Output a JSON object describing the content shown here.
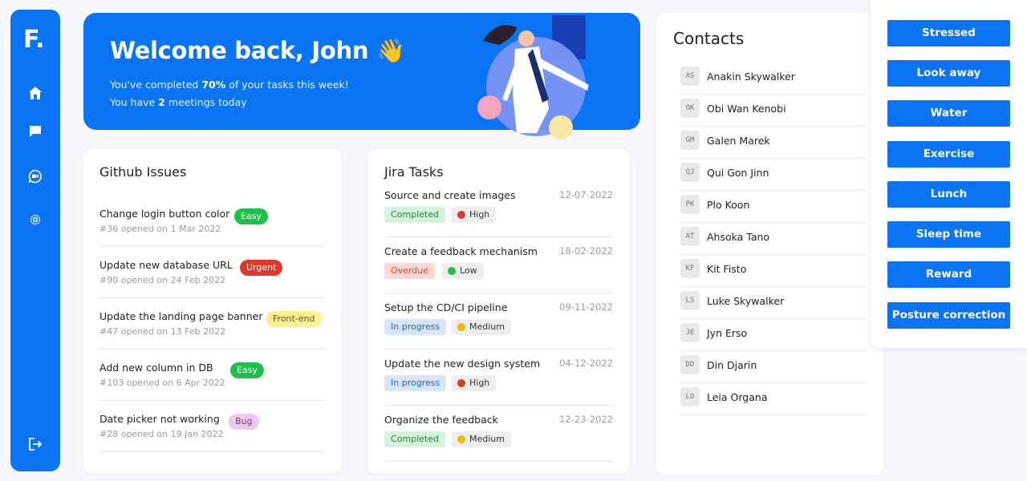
{
  "colors": {
    "primary": "#0a74f5",
    "easy": "#1fc04a",
    "urgent": "#e0392b",
    "frontend": "#fbf08a",
    "bug": "#f2c6f4"
  },
  "sidebar": {
    "logo": "F.",
    "items": [
      {
        "icon": "home-icon"
      },
      {
        "icon": "chat-icon"
      },
      {
        "icon": "video-chat-icon"
      },
      {
        "icon": "gear-icon"
      },
      {
        "icon": "logout-icon"
      }
    ]
  },
  "banner": {
    "title": "Welcome back, John 👋",
    "line1_prefix": "You've completed ",
    "line1_value": "70%",
    "line1_suffix": " of your tasks this week!",
    "line2_prefix": "You have ",
    "line2_value": "2",
    "line2_suffix": " meetings today"
  },
  "github": {
    "title": "Github Issues",
    "items": [
      {
        "title": "Change login button color",
        "sub": "#36 opened on 1 Mar 2022",
        "badge": "Easy"
      },
      {
        "title": "Update new database URL",
        "sub": "#90 opened on 24 Feb 2022",
        "badge": "Urgent"
      },
      {
        "title": "Update the landing page banner",
        "sub": "#47 opened on 13 Feb 2022",
        "badge": "Front-end"
      },
      {
        "title": "Add new column in DB",
        "sub": "#103 opened on 6 Apr 2022",
        "badge": "Easy"
      },
      {
        "title": "Date picker not working",
        "sub": "#28 opened on 19 Jan 2022",
        "badge": "Bug"
      }
    ]
  },
  "jira": {
    "title": "Jira Tasks",
    "items": [
      {
        "title": "Source and create images",
        "date": "12-07-2022",
        "status": "Completed",
        "priority": "High"
      },
      {
        "title": "Create a feedback mechanism",
        "date": "18-02-2022",
        "status": "Overdue",
        "priority": "Low"
      },
      {
        "title": "Setup the CD/CI pipeline",
        "date": "09-11-2022",
        "status": "In progress",
        "priority": "Medium"
      },
      {
        "title": "Update the new design system",
        "date": "04-12-2022",
        "status": "In progress",
        "priority": "High"
      },
      {
        "title": "Organize the feedback",
        "date": "12-23-2022",
        "status": "Completed",
        "priority": "Medium"
      }
    ]
  },
  "contacts": {
    "title": "Contacts",
    "items": [
      {
        "initials": "AS",
        "name": "Anakin Skywalker"
      },
      {
        "initials": "OK",
        "name": "Obi Wan Kenobi"
      },
      {
        "initials": "GM",
        "name": "Galen Marek"
      },
      {
        "initials": "QJ",
        "name": "Qui Gon Jinn"
      },
      {
        "initials": "PK",
        "name": "Plo Koon"
      },
      {
        "initials": "AT",
        "name": "Ahsoka Tano"
      },
      {
        "initials": "KF",
        "name": "Kit Fisto"
      },
      {
        "initials": "LS",
        "name": "Luke Skywalker"
      },
      {
        "initials": "JE",
        "name": "Jyn Erso"
      },
      {
        "initials": "DD",
        "name": "Din Djarin"
      },
      {
        "initials": "LO",
        "name": "Leia Organa"
      }
    ]
  },
  "reminders": {
    "buttons": [
      "Stressed",
      "Look away",
      "Water",
      "Exercise",
      "Lunch",
      "Sleep time",
      "Reward",
      "Posture correction"
    ]
  }
}
